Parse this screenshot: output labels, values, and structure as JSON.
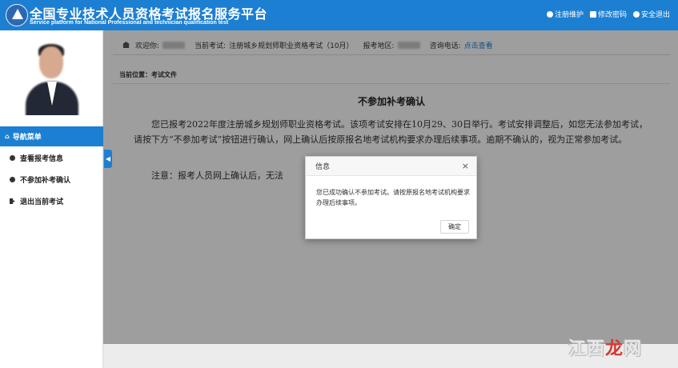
{
  "header": {
    "title_cn": "全国专业技术人员资格考试报名服务平台",
    "title_en": "Service platform for National Professional and technician qualification test",
    "logo_text": "PTA",
    "links": [
      {
        "label": "注册维护",
        "icon": "info-circle-icon"
      },
      {
        "label": "修改密码",
        "icon": "edit-icon"
      },
      {
        "label": "安全退出",
        "icon": "power-icon"
      }
    ]
  },
  "infobar": {
    "welcome_label": "欢迎你:",
    "exam_label": "当前考试:",
    "exam_value": "注册城乡规划师职业资格考试（10月）",
    "region_label": "报考地区:",
    "phone_label": "咨询电话:",
    "phone_link": "点击查看"
  },
  "sidebar": {
    "nav_title": "导航菜单",
    "items": [
      {
        "label": "查看报考信息",
        "icon": "info-dot-icon"
      },
      {
        "label": "不参加补考确认",
        "icon": "info-dot-icon"
      },
      {
        "label": "退出当前考试",
        "icon": "exit-icon"
      }
    ],
    "collapse_glyph": "◀"
  },
  "main": {
    "breadcrumb": "当前位置：考试文件",
    "doc_title": "不参加补考确认",
    "paragraph": "您已报考2022年度注册城乡规划师职业资格考试。该项考试安排在10月29、30日举行。考试安排调整后，如您无法参加考试，请按下方“不参加考试”按钮进行确认，网上确认后按原报名地考试机构要求办理后续事项。逾期不确认的，视为正常参加考试。",
    "note": "注意：报考人员网上确认后，无法"
  },
  "dialog": {
    "title": "信息",
    "close": "×",
    "message": "您已成功确认不参加考试。请按原报名地考试机构要求办理后续事项。",
    "ok": "确定"
  },
  "watermark": {
    "text_a": "江西",
    "text_b": "龙",
    "text_c": "网"
  },
  "colors": {
    "brand_blue": "#1d7fd1",
    "link_blue": "#1d7fd1",
    "watermark_red": "#d9352f"
  }
}
